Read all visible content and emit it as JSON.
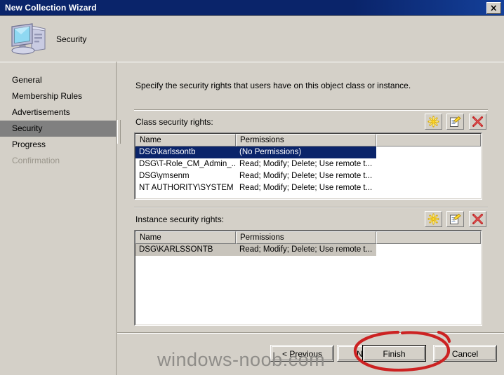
{
  "window": {
    "title": "New Collection Wizard",
    "close_icon": "close-icon",
    "header_title": "Security",
    "header_icon": "computer-icon"
  },
  "sidebar": {
    "items": [
      {
        "label": "General",
        "state": "normal"
      },
      {
        "label": "Membership Rules",
        "state": "normal"
      },
      {
        "label": "Advertisements",
        "state": "normal"
      },
      {
        "label": "Security",
        "state": "selected"
      },
      {
        "label": "Progress",
        "state": "normal"
      },
      {
        "label": "Confirmation",
        "state": "disabled"
      }
    ]
  },
  "main": {
    "intro": "Specify the security rights that users have on this object class or instance.",
    "class_section": {
      "label": "Class security rights:",
      "toolbar": [
        {
          "name": "new-icon",
          "title": "New"
        },
        {
          "name": "properties-icon",
          "title": "Properties"
        },
        {
          "name": "delete-icon",
          "title": "Delete"
        }
      ],
      "columns": [
        "Name",
        "Permissions"
      ],
      "rows": [
        {
          "name": "DSG\\karlssontb",
          "permissions": "(No Permissions)",
          "selected": "active"
        },
        {
          "name": "DSG\\T-Role_CM_Admin_...",
          "permissions": "Read; Modify; Delete; Use remote t...",
          "selected": "none"
        },
        {
          "name": "DSG\\ymsenm",
          "permissions": "Read; Modify; Delete; Use remote t...",
          "selected": "none"
        },
        {
          "name": "NT AUTHORITY\\SYSTEM",
          "permissions": "Read; Modify; Delete; Use remote t...",
          "selected": "none"
        }
      ]
    },
    "instance_section": {
      "label": "Instance security rights:",
      "toolbar": [
        {
          "name": "new-icon",
          "title": "New"
        },
        {
          "name": "properties-icon",
          "title": "Properties"
        },
        {
          "name": "delete-icon",
          "title": "Delete"
        }
      ],
      "columns": [
        "Name",
        "Permissions"
      ],
      "rows": [
        {
          "name": "DSG\\KARLSSONTB",
          "permissions": "Read; Modify; Delete; Use remote t...",
          "selected": "inactive"
        }
      ]
    }
  },
  "buttons": {
    "previous": "< Previous",
    "next": "Next >",
    "finish": "Finish",
    "cancel": "Cancel"
  },
  "watermark": "windows-noob.com",
  "annotation": {
    "name": "red-ellipse-annotation",
    "color": "#cc2222",
    "targets": "finish"
  },
  "colors": {
    "titlebar": "#0a246a",
    "face": "#d4d0c8",
    "selection_active": "#0a246a",
    "selection_inactive": "#c8c4bc",
    "sidebar_selected": "#808080",
    "annotation_red": "#cc2222"
  }
}
